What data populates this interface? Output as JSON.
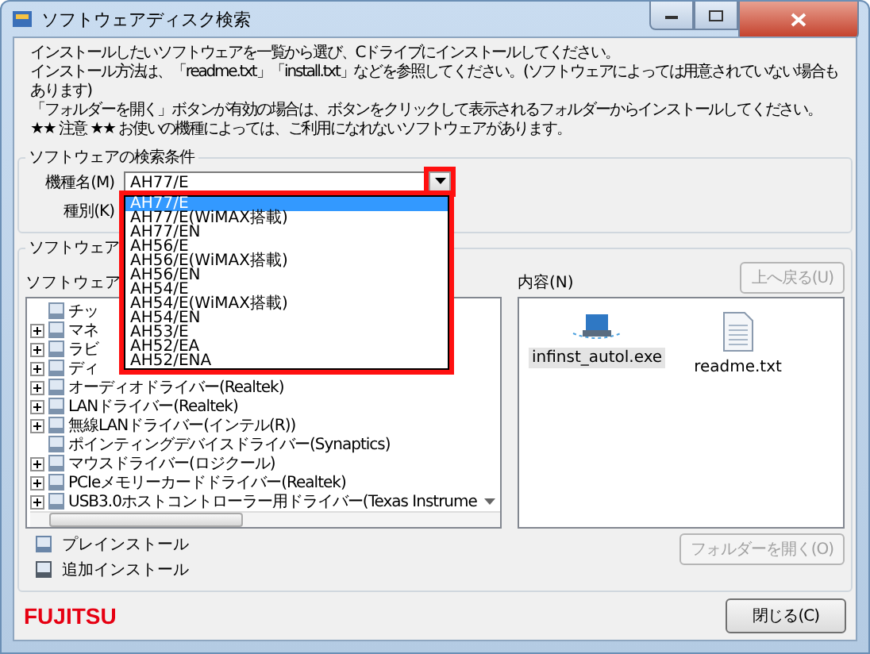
{
  "window": {
    "title": "ソフトウェアディスク検索"
  },
  "instructions": [
    "インストールしたいソフトウェアを一覧から選び、Cドライブにインストールしてください。",
    "インストール方法は、「readme.txt」「install.txt」などを参照してください。(ソフトウェアによっては用意されていない場合もあります)",
    "「フォルダーを開く」ボタンが有効の場合は、ボタンをクリックして表示されるフォルダーからインストールしてください。",
    "★★ 注意 ★★ お使いの機種によっては、ご利用になれないソフトウェアがあります。"
  ],
  "search_conditions": {
    "title": "ソフトウェアの検索条件",
    "model_label": "機種名(M)",
    "model_value": "AH77/E",
    "type_label": "種別(K)",
    "dropdown_options": [
      {
        "label": "AH77/E",
        "selected": true
      },
      {
        "label": "AH77/E(WiMAX搭載)",
        "selected": false
      },
      {
        "label": "AH77/EN",
        "selected": false
      },
      {
        "label": "AH56/E",
        "selected": false
      },
      {
        "label": "AH56/E(WiMAX搭載)",
        "selected": false
      },
      {
        "label": "AH56/EN",
        "selected": false
      },
      {
        "label": "AH54/E",
        "selected": false
      },
      {
        "label": "AH54/E(WiMAX搭載)",
        "selected": false
      },
      {
        "label": "AH54/EN",
        "selected": false
      },
      {
        "label": "AH53/E",
        "selected": false
      },
      {
        "label": "AH52/EA",
        "selected": false
      },
      {
        "label": "AH52/ENA",
        "selected": false
      }
    ]
  },
  "software": {
    "title": "ソフトウェア",
    "list_label": "ソフトウェア",
    "tree": [
      {
        "label": "チッ",
        "expandable": false
      },
      {
        "label": "マネ",
        "expandable": true
      },
      {
        "label": "ラビ",
        "expandable": true
      },
      {
        "label": "ディ",
        "expandable": true
      },
      {
        "label": "オーディオドライバー(Realtek)",
        "expandable": true
      },
      {
        "label": "LANドライバー(Realtek)",
        "expandable": true
      },
      {
        "label": "無線LANドライバー(インテル(R))",
        "expandable": true
      },
      {
        "label": "ポインティングデバイスドライバー(Synaptics)",
        "expandable": false
      },
      {
        "label": "マウスドライバー(ロジクール)",
        "expandable": true
      },
      {
        "label": "PCIeメモリーカードドライバー(Realtek)",
        "expandable": true
      },
      {
        "label": "USB3.0ホストコントローラー用ドライバー(Texas Instrume",
        "expandable": true
      }
    ],
    "contents_label": "内容(N)",
    "up_button": {
      "label": "上へ戻る(U)",
      "disabled": true
    },
    "files": [
      {
        "name": "infinst_autol.exe",
        "kind": "exe",
        "selected": true
      },
      {
        "name": "readme.txt",
        "kind": "text",
        "selected": false
      }
    ],
    "open_folder_button": {
      "label": "フォルダーを開く(O)",
      "disabled": true
    },
    "legend": [
      {
        "label": "プレインストール",
        "kind": "preinstall"
      },
      {
        "label": "追加インストール",
        "kind": "additional"
      }
    ]
  },
  "footer": {
    "logo": "FUJITSU",
    "close_button": "閉じる(C)"
  }
}
